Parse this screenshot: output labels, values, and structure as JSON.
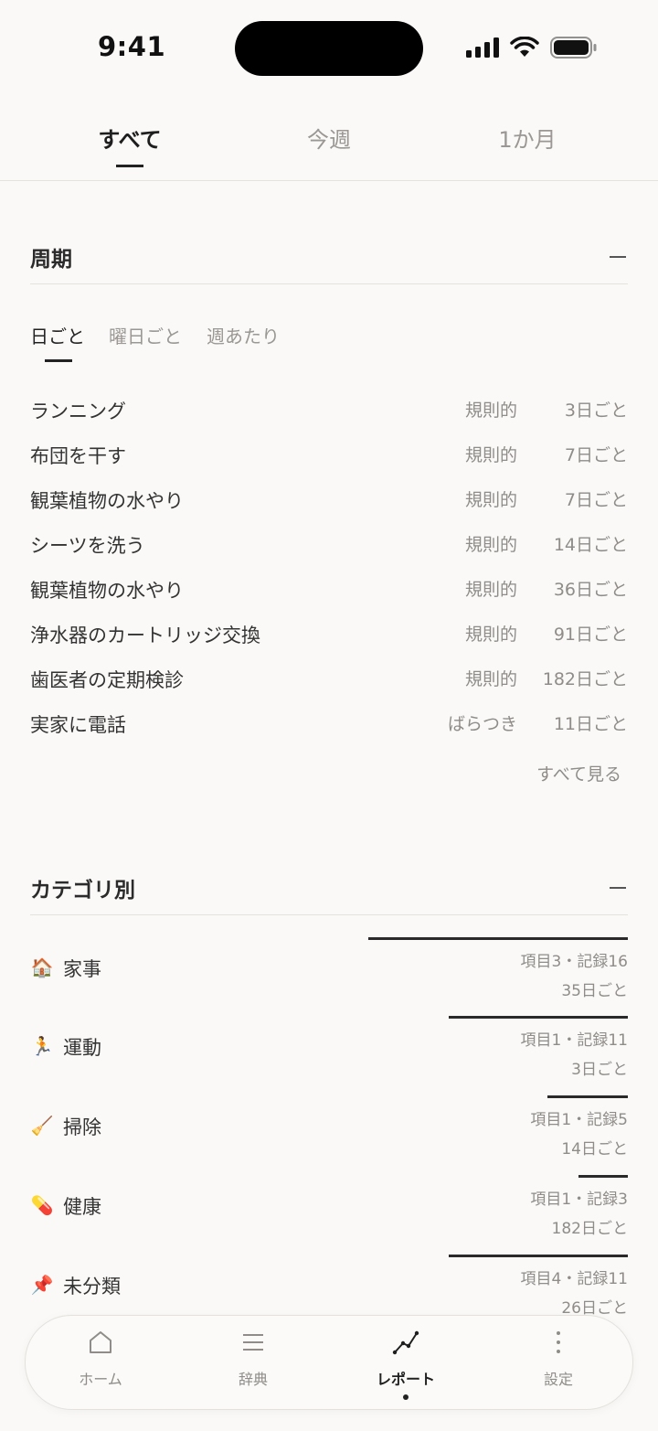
{
  "status_bar": {
    "time": "9:41"
  },
  "period_tabs": [
    {
      "label": "すべて",
      "active": true
    },
    {
      "label": "今週",
      "active": false
    },
    {
      "label": "1か月",
      "active": false
    }
  ],
  "cycle_section": {
    "title": "周期",
    "sub_tabs": [
      {
        "label": "日ごと",
        "active": true
      },
      {
        "label": "曜日ごと",
        "active": false
      },
      {
        "label": "週あたり",
        "active": false
      }
    ],
    "rows": [
      {
        "name": "ランニング",
        "kind": "規則的",
        "interval": "3日ごと"
      },
      {
        "name": "布団を干す",
        "kind": "規則的",
        "interval": "7日ごと"
      },
      {
        "name": "観葉植物の水やり",
        "kind": "規則的",
        "interval": "7日ごと"
      },
      {
        "name": "シーツを洗う",
        "kind": "規則的",
        "interval": "14日ごと"
      },
      {
        "name": "観葉植物の水やり",
        "kind": "規則的",
        "interval": "36日ごと"
      },
      {
        "name": "浄水器のカートリッジ交換",
        "kind": "規則的",
        "interval": "91日ごと"
      },
      {
        "name": "歯医者の定期検診",
        "kind": "規則的",
        "interval": "182日ごと"
      },
      {
        "name": "実家に電話",
        "kind": "ばらつき",
        "interval": "11日ごと"
      }
    ],
    "see_all": "すべて見る"
  },
  "category_section": {
    "title": "カテゴリ別",
    "rows": [
      {
        "emoji": "🏠",
        "name": "家事",
        "stats": "項目3・記録16",
        "interval": "35日ごと",
        "share": 1.0
      },
      {
        "emoji": "🏃",
        "name": "運動",
        "stats": "項目1・記録11",
        "interval": "3日ごと",
        "share": 0.69
      },
      {
        "emoji": "🧹",
        "name": "掃除",
        "stats": "項目1・記録5",
        "interval": "14日ごと",
        "share": 0.31
      },
      {
        "emoji": "💊",
        "name": "健康",
        "stats": "項目1・記録3",
        "interval": "182日ごと",
        "share": 0.19
      },
      {
        "emoji": "📌",
        "name": "未分類",
        "stats": "項目4・記録11",
        "interval": "26日ごと",
        "share": 0.69
      }
    ]
  },
  "bottom_nav": [
    {
      "label": "ホーム",
      "icon": "home-icon",
      "active": false
    },
    {
      "label": "辞典",
      "icon": "list-icon",
      "active": false
    },
    {
      "label": "レポート",
      "icon": "chart-line-icon",
      "active": true
    },
    {
      "label": "設定",
      "icon": "more-vertical-icon",
      "active": false
    }
  ]
}
